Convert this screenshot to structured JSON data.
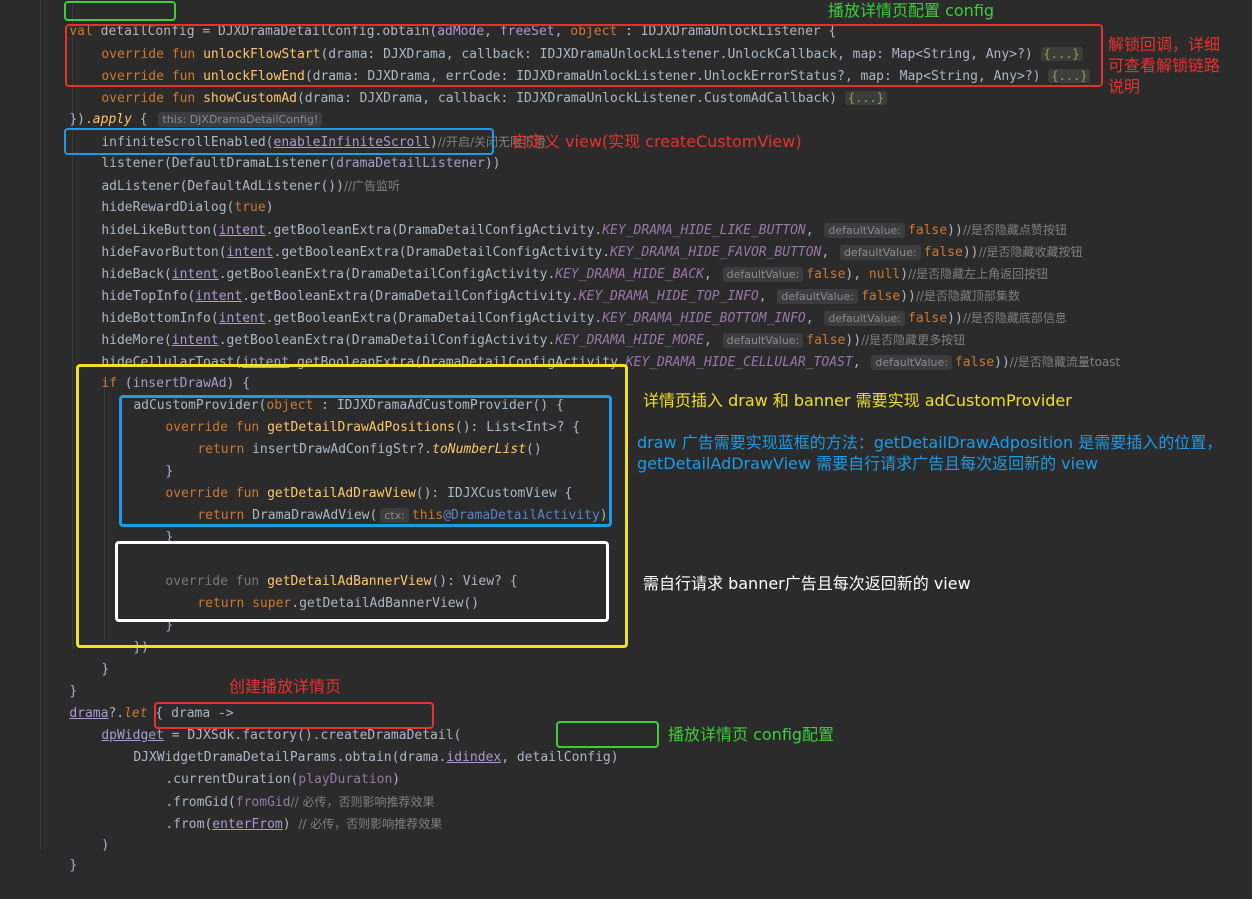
{
  "code": {
    "l1": {
      "kw_val": "val ",
      "var": "detailConfig",
      "rest": " = DJXDramaDetailConfig.obtain(",
      "p1": "adMode",
      ", ": ", ",
      "p2": "freeSet",
      ", 2": ", ",
      "kw_obj": "object",
      ": ": " : IDJXDramaUnlockListener {"
    },
    "l2": {
      "kw": "override fun ",
      "fn": "unlockFlowStart",
      "rest": "(drama: DJXDrama, callback: IDJXDramaUnlockListener.UnlockCallback, map: Map<String, Any>?) ",
      "fold": "{...}"
    },
    "l3": {
      "kw": "override fun ",
      "fn": "unlockFlowEnd",
      "rest": "(drama: DJXDrama, errCode: IDJXDramaUnlockListener.UnlockErrorStatus?, map: Map<String, Any>?) ",
      "fold": "{...}"
    },
    "l4": {
      "kw": "override fun ",
      "fn": "showCustomAd",
      "rest": "(drama: DJXDrama, callback: IDJXDramaUnlockListener.CustomAdCallback) ",
      "fold": "{...}"
    },
    "l5": {
      "pre": "}).",
      "apply": "apply",
      " {": " { ",
      "hint": "this: DJXDramaDetailConfig!"
    },
    "l6": {
      "fn": "infiniteScrollEnabled(",
      "param": "enableInfiniteScroll",
      ")": ")",
      "cmt": "//开启/关闭无限下滑"
    },
    "l7": {
      "text": "listener(DefaultDramaListener(",
      "param": "dramaDetailListener",
      "end": "))"
    },
    "l8": {
      "text": "adListener(DefaultAdListener())",
      "cmt": "//广告监听"
    },
    "l9": {
      "text": "hideRewardDialog(",
      "kw": "true",
      ")": ")"
    },
    "l10": {
      "text": "hideLikeButton(",
      "intent": "intent",
      "mid": ".getBooleanExtra(DramaDetailConfigActivity.",
      "const": "KEY_DRAMA_HIDE_LIKE_BUTTON",
      ", ": ", ",
      "hint": "defaultValue:",
      "kw": "false",
      "end": "))",
      "cmt": "//是否隐藏点赞按钮"
    },
    "l11": {
      "text": "hideFavorButton(",
      "intent": "intent",
      "mid": ".getBooleanExtra(DramaDetailConfigActivity.",
      "const": "KEY_DRAMA_HIDE_FAVOR_BUTTON",
      ", ": ", ",
      "hint": "defaultValue:",
      "kw": "false",
      "end": "))",
      "cmt": "//是否隐藏收藏按钮"
    },
    "l12": {
      "text": "hideBack(",
      "intent": "intent",
      "mid": ".getBooleanExtra(DramaDetailConfigActivity.",
      "const": "KEY_DRAMA_HIDE_BACK",
      ", ": ", ",
      "hint": "defaultValue:",
      "kw": "false",
      "mid2": "), ",
      "kw2": "null",
      "end": ")",
      "cmt": "//是否隐藏左上角返回按钮"
    },
    "l13": {
      "text": "hideTopInfo(",
      "intent": "intent",
      "mid": ".getBooleanExtra(DramaDetailConfigActivity.",
      "const": "KEY_DRAMA_HIDE_TOP_INFO",
      ", ": ", ",
      "hint": "defaultValue:",
      "kw": "false",
      "end": "))",
      "cmt": "//是否隐藏顶部集数"
    },
    "l14": {
      "text": "hideBottomInfo(",
      "intent": "intent",
      "mid": ".getBooleanExtra(DramaDetailConfigActivity.",
      "const": "KEY_DRAMA_HIDE_BOTTOM_INFO",
      ", ": ", ",
      "hint": "defaultValue:",
      "kw": "false",
      "end": "))",
      "cmt": "//是否隐藏底部信息"
    },
    "l15": {
      "text": "hideMore(",
      "intent": "intent",
      "mid": ".getBooleanExtra(DramaDetailConfigActivity.",
      "const": "KEY_DRAMA_HIDE_MORE",
      ", ": ", ",
      "hint": "defaultValue:",
      "kw": "false",
      "end": "))",
      "cmt": "//是否隐藏更多按钮"
    },
    "l16": {
      "text": "hideCellularToast(",
      "intent": "intent",
      "mid": ".getBooleanExtra(DramaDetailConfigActivity.",
      "const": "KEY_DRAMA_HIDE_CELLULAR_TOAST",
      ", ": ", ",
      "hint": "defaultValue:",
      "kw": "false",
      "end": "))",
      "cmt": "//是否隐藏流量toast"
    },
    "l17": {
      "kw": "if ",
      "p": "(",
      "param": "insertDrawAd",
      ")": ") {"
    },
    "l18": {
      "text": "adCustomProvider(",
      "kw": "object",
      ": ": " : IDJXDramaAdCustomProvider() {"
    },
    "l19": {
      "kw": "override fun ",
      "fn": "getDetailDrawAdPositions",
      "rest": "(): List<Int>? {"
    },
    "l20": {
      "kw": "return ",
      "text": "insertDrawAdConfigStr?.",
      "ital": "toNumberList",
      "end": "()"
    },
    "l21": {
      "text": "}"
    },
    "l22": {
      "kw": "override fun ",
      "fn": "getDetailAdDrawView",
      "rest": "(): IDJXCustomView {"
    },
    "l23": {
      "kw": "return ",
      "text": "DramaDrawAdView(",
      "hint": "ctx:",
      "kw2": "this",
      "lbl": "@DramaDetailActivity",
      "end": ")"
    },
    "l24": {
      "text": "}"
    },
    "l25": {
      "kw": "override fun ",
      "fn": "getDetailAdBannerView",
      "rest": "(): View? {"
    },
    "l26": {
      "kw": "return ",
      "kw2": "super",
      "rest": ".getDetailAdBannerView()"
    },
    "l27": {
      "text": "}"
    },
    "l28": {
      "text": "})"
    },
    "l29": {
      "text": "}"
    },
    "l30": {
      "text": "}"
    },
    "l31": {
      "drama": "drama",
      "rest": "?.",
      "let": "let",
      " { drama ->": " { drama ->"
    },
    "l32": {
      "dp": "dpWidget",
      " = ": " = ",
      "call": "DJXSdk.factory().createDramaDetail(",
      "end": ""
    },
    "l33": {
      "text": "DJXWidgetDramaDetailParams.obtain(drama.",
      "id": "id",
      ", drama.": ", drama.",
      "index": "index",
      ", ": ", ",
      "cfg": "detailConfig",
      ")": ")"
    },
    "l34": {
      "text": ".currentDuration(",
      "prop": "playDuration",
      ")": ")"
    },
    "l35": {
      "text": ".fromGid(",
      "prop": "fromGid",
      ".toString())": ".toString()) ",
      "cmt": "// 必传，否则影响推荐效果"
    },
    "l36": {
      "text": ".from(",
      "prop": "enterFrom",
      ")": ") ",
      "cmt": "// 必传，否则影响推荐效果"
    },
    "l37": {
      "text": ")"
    },
    "l38": {
      "text": "}"
    }
  },
  "notes": {
    "config": "播放详情页配置 config",
    "unlock": [
      "解锁回调，详细",
      "可查看解锁链路",
      "说明"
    ],
    "custom_view": "自定义 view(实现 createCustomView)",
    "provider": "详情页插入 draw 和 banner 需要实现 adCustomProvider",
    "draw": [
      "draw 广告需要实现蓝框的方法：getDetailDrawAdposition 是需要插入的位置，",
      "getDetailAdDrawView 需要自行请求广告且每次返回新的 view"
    ],
    "banner": "需自行请求 banner广告且每次返回新的 view",
    "create": "创建播放详情页",
    "config2": "播放详情页 config配置"
  },
  "colors": {
    "red": "#e8312f",
    "green": "#3ccf3a",
    "blue": "#1e9be6",
    "yellow": "#f0df2d",
    "white": "#ffffff"
  }
}
